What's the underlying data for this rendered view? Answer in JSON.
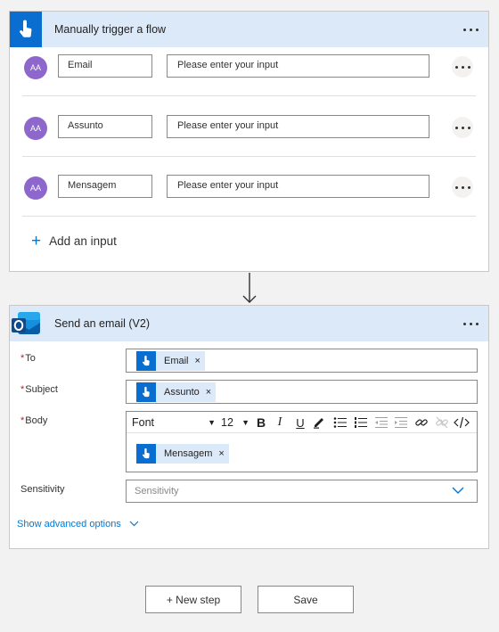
{
  "trigger": {
    "title": "Manually trigger a flow",
    "icon": "touch-hand-icon",
    "inputs": [
      {
        "name": "Email",
        "placeholder": "Please enter your input"
      },
      {
        "name": "Assunto",
        "placeholder": "Please enter your input"
      },
      {
        "name": "Mensagem",
        "placeholder": "Please enter your input"
      }
    ],
    "add_input_label": "Add an input",
    "avatar_text": "AA"
  },
  "action": {
    "title": "Send an email (V2)",
    "icon": "outlook-icon",
    "fields": {
      "to_label": "To",
      "subject_label": "Subject",
      "body_label": "Body",
      "sensitivity_label": "Sensitivity",
      "required_mark": "*"
    },
    "tokens": {
      "to": "Email",
      "subject": "Assunto",
      "body": "Mensagem",
      "remove": "×"
    },
    "toolbar": {
      "font": "Font",
      "size": "12"
    },
    "sensitivity_placeholder": "Sensitivity",
    "show_advanced": "Show advanced options"
  },
  "buttons": {
    "new_step": "+ New step",
    "save": "Save"
  },
  "colors": {
    "header_bg": "#dbe9f9",
    "accent": "#0078d4",
    "trigger_icon_bg": "#0a6ed1",
    "avatar_bg": "#8d67cc"
  }
}
